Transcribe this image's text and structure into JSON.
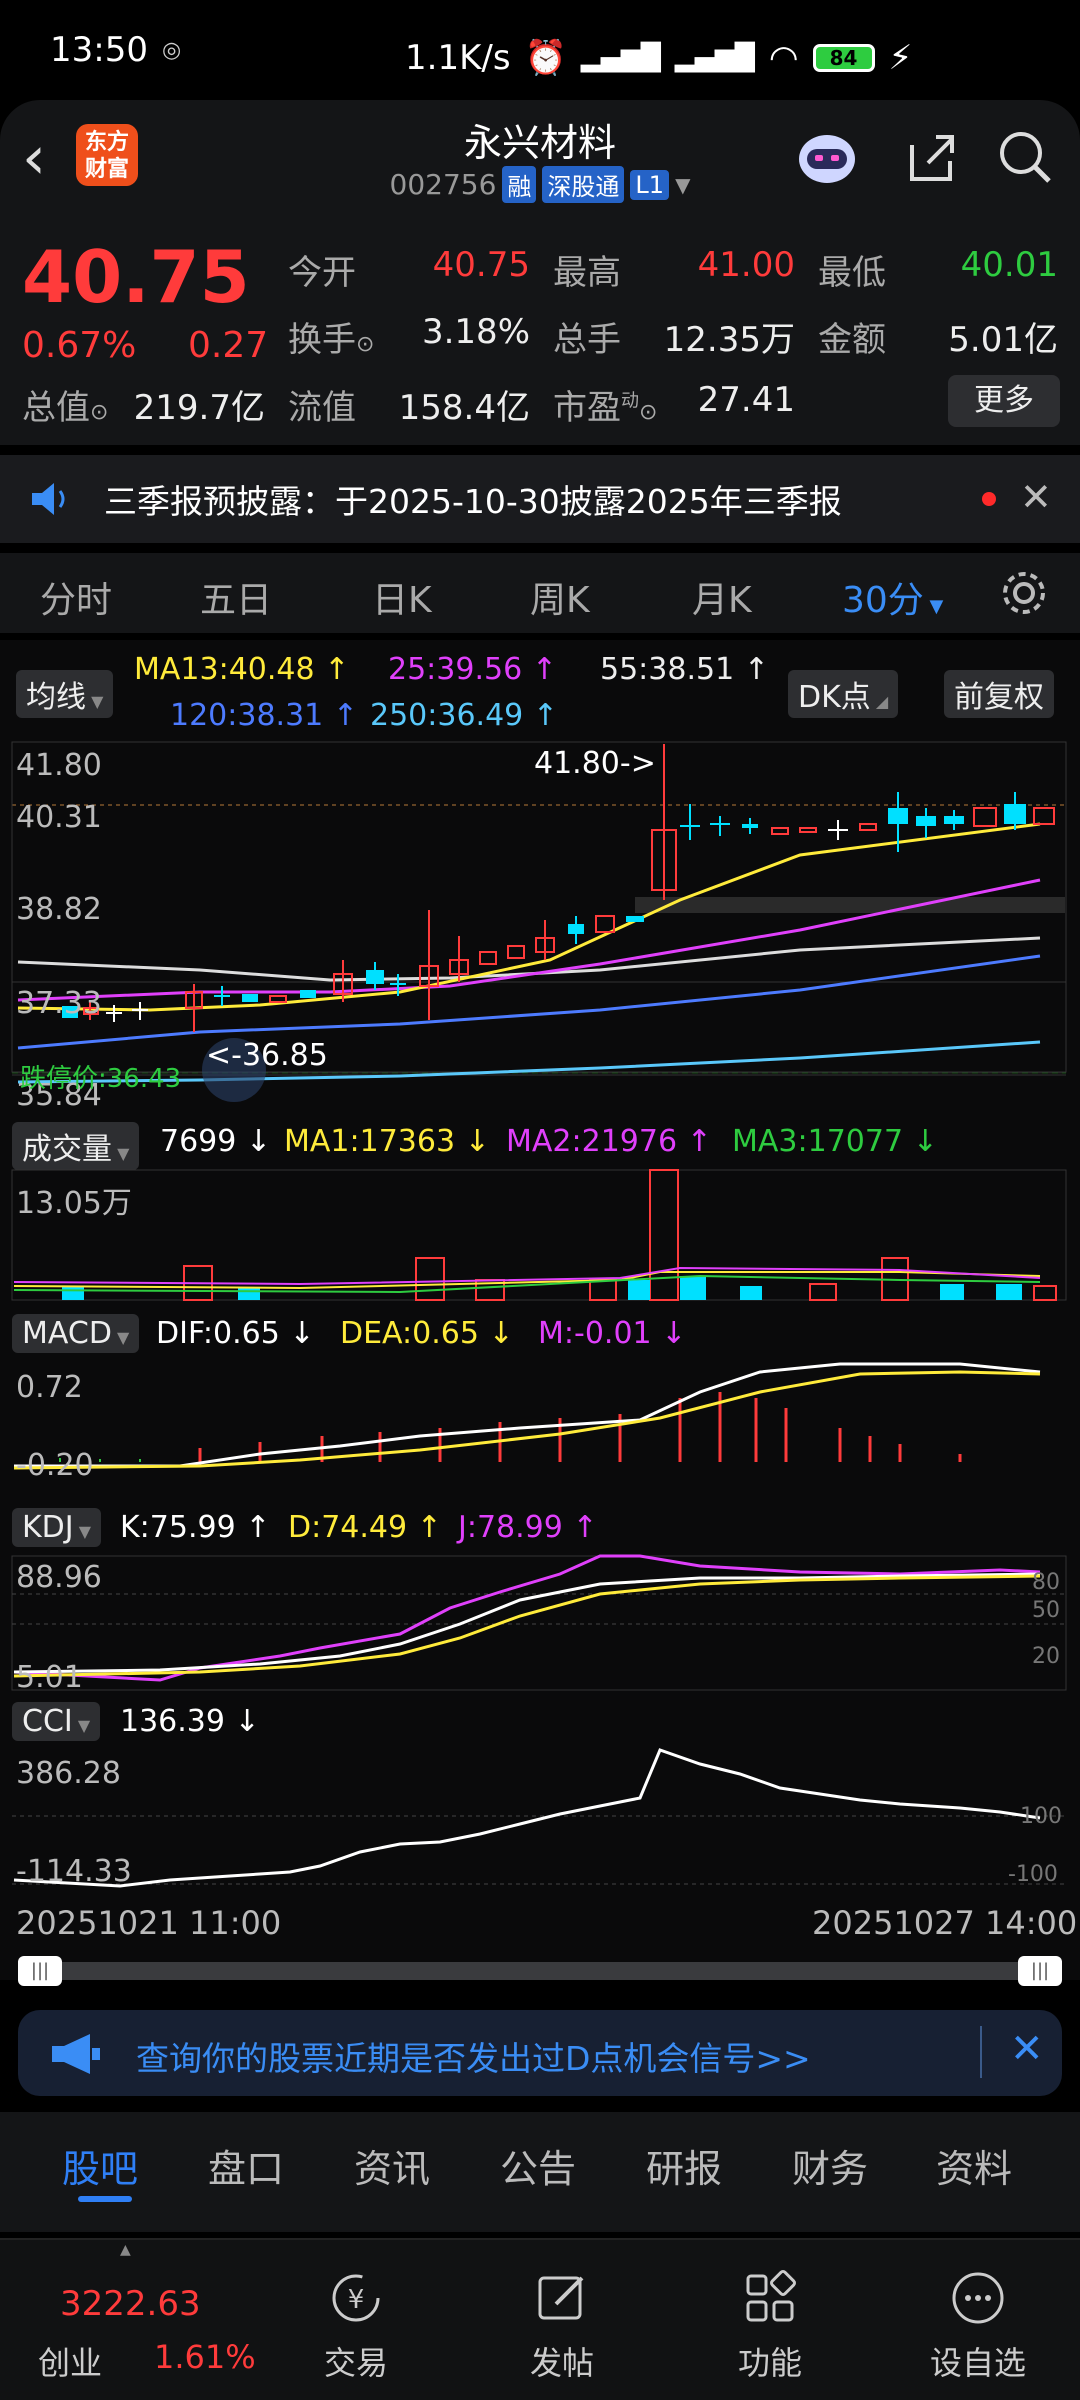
{
  "status": {
    "time": "13:50",
    "speed": "1.1K/s",
    "battery": "84"
  },
  "header": {
    "logo_line1": "东方",
    "logo_line2": "财富",
    "title": "永兴材料",
    "code": "002756",
    "tags": [
      "融",
      "深股通",
      "L1"
    ]
  },
  "quote": {
    "price": "40.75",
    "change_pct": "0.67%",
    "change": "0.27",
    "rows": [
      [
        {
          "label": "今开",
          "value": "40.75"
        },
        {
          "label": "最高",
          "value": "41.00"
        },
        {
          "label": "最低",
          "value": "40.01"
        }
      ],
      [
        {
          "label": "换手",
          "value": "3.18%"
        },
        {
          "label": "总手",
          "value": "12.35万"
        },
        {
          "label": "金额",
          "value": "5.01亿"
        }
      ],
      [
        {
          "label": "总值",
          "value": "219.7亿"
        },
        {
          "label": "流值",
          "value": "158.4亿"
        },
        {
          "label": "市盈",
          "value": "27.41"
        }
      ]
    ],
    "pe_sup": "动",
    "more": "更多"
  },
  "notice": {
    "text": "三季报预披露：于2025-10-30披露2025年三季报"
  },
  "tabs": [
    "分时",
    "五日",
    "日K",
    "周K",
    "月K",
    "30分"
  ],
  "chart": {
    "ma_select": "均线",
    "ma13": "MA13:40.48",
    "ma25": "25:39.56",
    "ma55": "55:38.51",
    "ma120": "120:38.31",
    "ma250": "250:36.49",
    "dk": "DK点",
    "fq": "前复权",
    "price_axis": [
      "41.80",
      "40.31",
      "38.82",
      "37.33",
      "35.84"
    ],
    "high_mark": "41.80->",
    "low_mark": "<-36.85",
    "limit_down": "跌停价:36.43",
    "vol": {
      "select": "成交量",
      "value": "7699",
      "ma1": "MA1:17363",
      "ma2": "MA2:21976",
      "ma3": "MA3:17077",
      "axis": "13.05万"
    },
    "macd": {
      "select": "MACD",
      "dif": "DIF:0.65",
      "dea": "DEA:0.65",
      "m": "M:-0.01",
      "axis_top": "0.72",
      "axis_bottom": "-0.20"
    },
    "kdj": {
      "select": "KDJ",
      "k": "K:75.99",
      "d": "D:74.49",
      "j": "J:78.99",
      "axis_top": "88.96",
      "axis_bottom": "5.01",
      "ref": [
        "80",
        "50",
        "20"
      ]
    },
    "cci": {
      "select": "CCI",
      "value": "136.39",
      "axis_top": "386.28",
      "axis_bottom": "-114.33",
      "ref": [
        "100",
        "-100"
      ]
    },
    "date_start": "20251021 11:00",
    "date_end": "20251027 14:00"
  },
  "banner": {
    "text": "查询你的股票近期是否发出过D点机会信号>>"
  },
  "bottom_tabs": [
    "股吧",
    "盘口",
    "资讯",
    "公告",
    "研报",
    "财务",
    "资料"
  ],
  "nav": {
    "index_value": "3222.63",
    "index_name": "创业",
    "index_pct": "1.61%",
    "items": [
      "交易",
      "发帖",
      "功能",
      "设自选"
    ]
  },
  "colors": {
    "up": "#ff3b3b",
    "down": "#2ecc40",
    "accent": "#2f7ff5"
  }
}
